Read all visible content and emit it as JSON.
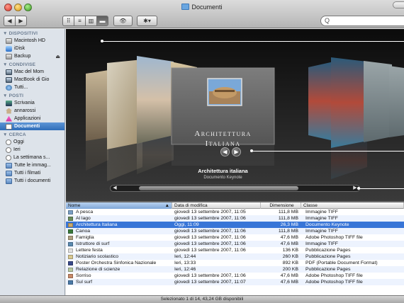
{
  "window": {
    "title": "Documenti"
  },
  "toolbar": {
    "back": "◀",
    "forward": "▶",
    "view_icons": "⠿",
    "view_list": "≡",
    "view_columns": "▥",
    "view_coverflow": "▬",
    "quicklook": "👁",
    "action": "✱▾",
    "search_placeholder": "Q"
  },
  "sidebar": {
    "sections": [
      {
        "title": "▼ DISPOSITIVI",
        "items": [
          {
            "label": "Macintosh HD",
            "icon": "disk-icon"
          },
          {
            "label": "iDisk",
            "icon": "idisk-icon"
          },
          {
            "label": "Backup",
            "icon": "disk-icon",
            "eject": "⏏"
          }
        ]
      },
      {
        "title": "▼ CONDIVISE",
        "items": [
          {
            "label": "Mac del Mom",
            "icon": "mac-icon"
          },
          {
            "label": "MacBook di Gio",
            "icon": "mac-icon"
          },
          {
            "label": "Tutti...",
            "icon": "network-icon"
          }
        ]
      },
      {
        "title": "▼ POSTI",
        "items": [
          {
            "label": "Scrivania",
            "icon": "desktop-icon"
          },
          {
            "label": "annarossi",
            "icon": "home-icon"
          },
          {
            "label": "Applicazioni",
            "icon": "applications-icon"
          },
          {
            "label": "Documenti",
            "icon": "documents-icon",
            "selected": true
          }
        ]
      },
      {
        "title": "▼ CERCA",
        "items": [
          {
            "label": "Oggi",
            "icon": "clock-icon"
          },
          {
            "label": "Ieri",
            "icon": "clock-icon"
          },
          {
            "label": "La settimana s...",
            "icon": "clock-icon"
          },
          {
            "label": "Tutte le immag...",
            "icon": "smart-folder-icon"
          },
          {
            "label": "Tutti i filmati",
            "icon": "smart-folder-icon"
          },
          {
            "label": "Tutti i documenti",
            "icon": "smart-folder-icon"
          }
        ]
      }
    ]
  },
  "coverflow": {
    "center_caption_line1": "Architettura",
    "center_caption_line2": "Italiana",
    "selected_name": "Architettura italiana",
    "selected_kind": "Documento Keynote",
    "prev_arrow": "◀",
    "next_arrow": "▶"
  },
  "table": {
    "headers": {
      "name": "Nome",
      "sort_indicator": "▲",
      "modified": "Data di modifica",
      "size": "Dimensione",
      "kind": "Classe"
    },
    "rows": [
      {
        "name": "A pesca",
        "modified": "giovedì 13 settembre 2007, 11:05",
        "size": "111,8 MB",
        "kind": "Immagine TIFF",
        "color": "#7a9fc4"
      },
      {
        "name": "Al lago",
        "modified": "giovedì 13 settembre 2007, 11:06",
        "size": "111,8 MB",
        "kind": "Immagine TIFF",
        "color": "#6a8b5a"
      },
      {
        "name": "Architettura Italiana",
        "modified": "Oggi, 11:09",
        "size": "26,3 MB",
        "kind": "Documento Keynote",
        "color": "#c9a86b",
        "selected": true
      },
      {
        "name": "Canoa",
        "modified": "giovedì 13 settembre 2007, 11:06",
        "size": "111,8 MB",
        "kind": "Immagine TIFF",
        "color": "#3b7a3b"
      },
      {
        "name": "Famiglia",
        "modified": "giovedì 13 settembre 2007, 11:06",
        "size": "47,6 MB",
        "kind": "Adobe Photoshop TIFF file",
        "color": "#b0a080"
      },
      {
        "name": "Istruttore di surf",
        "modified": "giovedì 13 settembre 2007, 11:06",
        "size": "47,6 MB",
        "kind": "Immagine TIFF",
        "color": "#5a8ab0"
      },
      {
        "name": "Lettere festa",
        "modified": "giovedì 13 settembre 2007, 11:06",
        "size": "136 KB",
        "kind": "Pubblicazione Pages",
        "color": "#e0e0e0"
      },
      {
        "name": "Notiziario scolastico",
        "modified": "Ieri, 12:44",
        "size": "260 KB",
        "kind": "Pubblicazione Pages",
        "color": "#d8c890"
      },
      {
        "name": "Poster Orchestra Sinfonica Nazionale",
        "modified": "Ieri, 13:33",
        "size": "892 KB",
        "kind": "PDF (Portable Document Format)",
        "color": "#3a4a8a"
      },
      {
        "name": "Relazione di scienze",
        "modified": "Ieri, 12:46",
        "size": "200 KB",
        "kind": "Pubblicazione Pages",
        "color": "#b8c8a0"
      },
      {
        "name": "Sorriso",
        "modified": "giovedì 13 settembre 2007, 11:06",
        "size": "47,6 MB",
        "kind": "Adobe Photoshop TIFF file",
        "color": "#c88a6a"
      },
      {
        "name": "Sul surf",
        "modified": "giovedì 13 settembre 2007, 11:07",
        "size": "47,6 MB",
        "kind": "Adobe Photoshop TIFF file",
        "color": "#4a7aa8"
      }
    ]
  },
  "status": {
    "text": "Selezionato 1 di 14, 43,24 GB disponibili"
  }
}
